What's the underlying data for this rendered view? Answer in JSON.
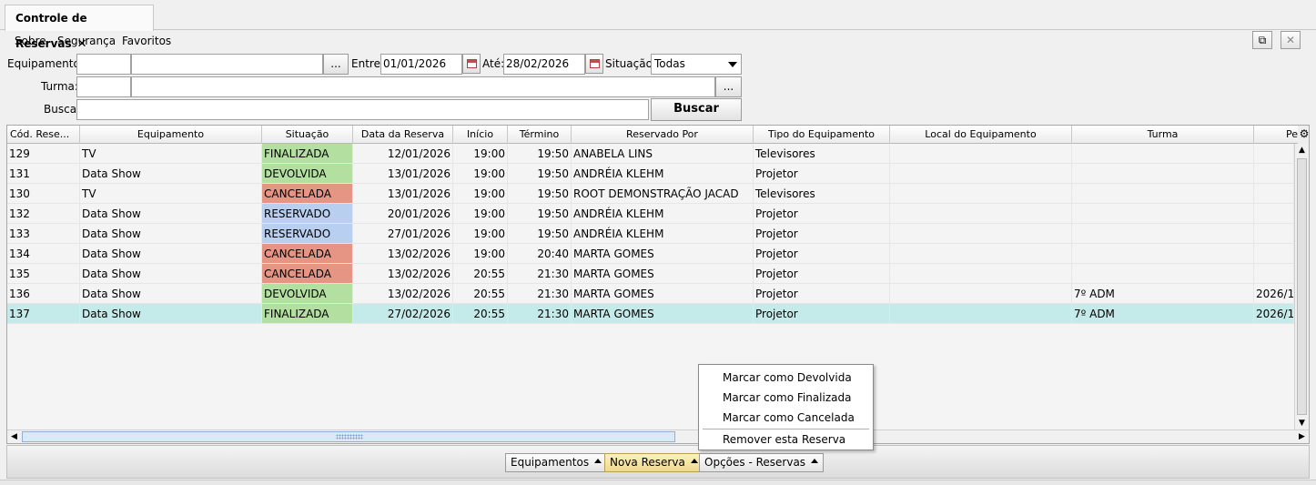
{
  "tab": {
    "title": "Controle de Reservas",
    "close": "✕"
  },
  "menu": [
    "Sobre",
    "Segurança",
    "Favoritos"
  ],
  "window_buttons": {
    "popout": "⧉",
    "close": "✕"
  },
  "filters": {
    "equipamento_label": "Equipamento:",
    "equipamento_code": "",
    "equipamento_name": "",
    "browse": "...",
    "entre_label": "Entre:",
    "entre_value": "01/01/2026",
    "ate_label": "Até:",
    "ate_value": "28/02/2026",
    "situacao_label": "Situação:",
    "situacao_value": "Todas",
    "turma_label": "Turma:",
    "turma_code": "",
    "turma_name": "",
    "busca_label": "Busca:",
    "busca_value": "",
    "buscar_button": "Buscar"
  },
  "table": {
    "columns": [
      "Cód. Rese...",
      "Equipamento",
      "Situação",
      "Data da Reserva",
      "Início",
      "Término",
      "Reservado Por",
      "Tipo do Equipamento",
      "Local do Equipamento",
      "Turma",
      "Pe"
    ],
    "gear": "⚙",
    "rows": [
      {
        "cod": "129",
        "equip": "TV",
        "sit": "FINALIZADA",
        "sit_key": "finalizada",
        "data": "12/01/2026",
        "inicio": "19:00",
        "termino": "19:50",
        "por": "ANABELA LINS",
        "tipo": "Televisores",
        "local": "",
        "turma": "",
        "pe": "",
        "selected": false
      },
      {
        "cod": "131",
        "equip": "Data Show",
        "sit": "DEVOLVIDA",
        "sit_key": "devolvida",
        "data": "13/01/2026",
        "inicio": "19:00",
        "termino": "19:50",
        "por": "ANDRÉIA KLEHM",
        "tipo": "Projetor",
        "local": "",
        "turma": "",
        "pe": "",
        "selected": false
      },
      {
        "cod": "130",
        "equip": "TV",
        "sit": "CANCELADA",
        "sit_key": "cancelada",
        "data": "13/01/2026",
        "inicio": "19:00",
        "termino": "19:50",
        "por": "ROOT DEMONSTRAÇÃO JACAD",
        "tipo": "Televisores",
        "local": "",
        "turma": "",
        "pe": "",
        "selected": false
      },
      {
        "cod": "132",
        "equip": "Data Show",
        "sit": "RESERVADO",
        "sit_key": "reservado",
        "data": "20/01/2026",
        "inicio": "19:00",
        "termino": "19:50",
        "por": "ANDRÉIA KLEHM",
        "tipo": "Projetor",
        "local": "",
        "turma": "",
        "pe": "",
        "selected": false
      },
      {
        "cod": "133",
        "equip": "Data Show",
        "sit": "RESERVADO",
        "sit_key": "reservado",
        "data": "27/01/2026",
        "inicio": "19:00",
        "termino": "19:50",
        "por": "ANDRÉIA KLEHM",
        "tipo": "Projetor",
        "local": "",
        "turma": "",
        "pe": "",
        "selected": false
      },
      {
        "cod": "134",
        "equip": "Data Show",
        "sit": "CANCELADA",
        "sit_key": "cancelada",
        "data": "13/02/2026",
        "inicio": "19:00",
        "termino": "20:40",
        "por": "MARTA GOMES",
        "tipo": "Projetor",
        "local": "",
        "turma": "",
        "pe": "",
        "selected": false
      },
      {
        "cod": "135",
        "equip": "Data Show",
        "sit": "CANCELADA",
        "sit_key": "cancelada",
        "data": "13/02/2026",
        "inicio": "20:55",
        "termino": "21:30",
        "por": "MARTA GOMES",
        "tipo": "Projetor",
        "local": "",
        "turma": "",
        "pe": "",
        "selected": false
      },
      {
        "cod": "136",
        "equip": "Data Show",
        "sit": "DEVOLVIDA",
        "sit_key": "devolvida",
        "data": "13/02/2026",
        "inicio": "20:55",
        "termino": "21:30",
        "por": "MARTA GOMES",
        "tipo": "Projetor",
        "local": "",
        "turma": "7º ADM",
        "pe": "2026/1",
        "selected": false
      },
      {
        "cod": "137",
        "equip": "Data Show",
        "sit": "FINALIZADA",
        "sit_key": "finalizada",
        "data": "27/02/2026",
        "inicio": "20:55",
        "termino": "21:30",
        "por": "MARTA GOMES",
        "tipo": "Projetor",
        "local": "",
        "turma": "7º ADM",
        "pe": "2026/1",
        "selected": true
      }
    ]
  },
  "status_colors": {
    "finalizada": "#b3e0a0",
    "devolvida": "#b3e0a0",
    "cancelada": "#e69584",
    "reservado": "#b9cfef",
    "selected_row": "#c5eaea"
  },
  "bottom_buttons": [
    "Equipamentos",
    "Nova Reserva",
    "Opções - Reservas"
  ],
  "context_menu": [
    "Marcar como Devolvida",
    "Marcar como Finalizada",
    "Marcar como Cancelada",
    "Remover esta Reserva"
  ]
}
